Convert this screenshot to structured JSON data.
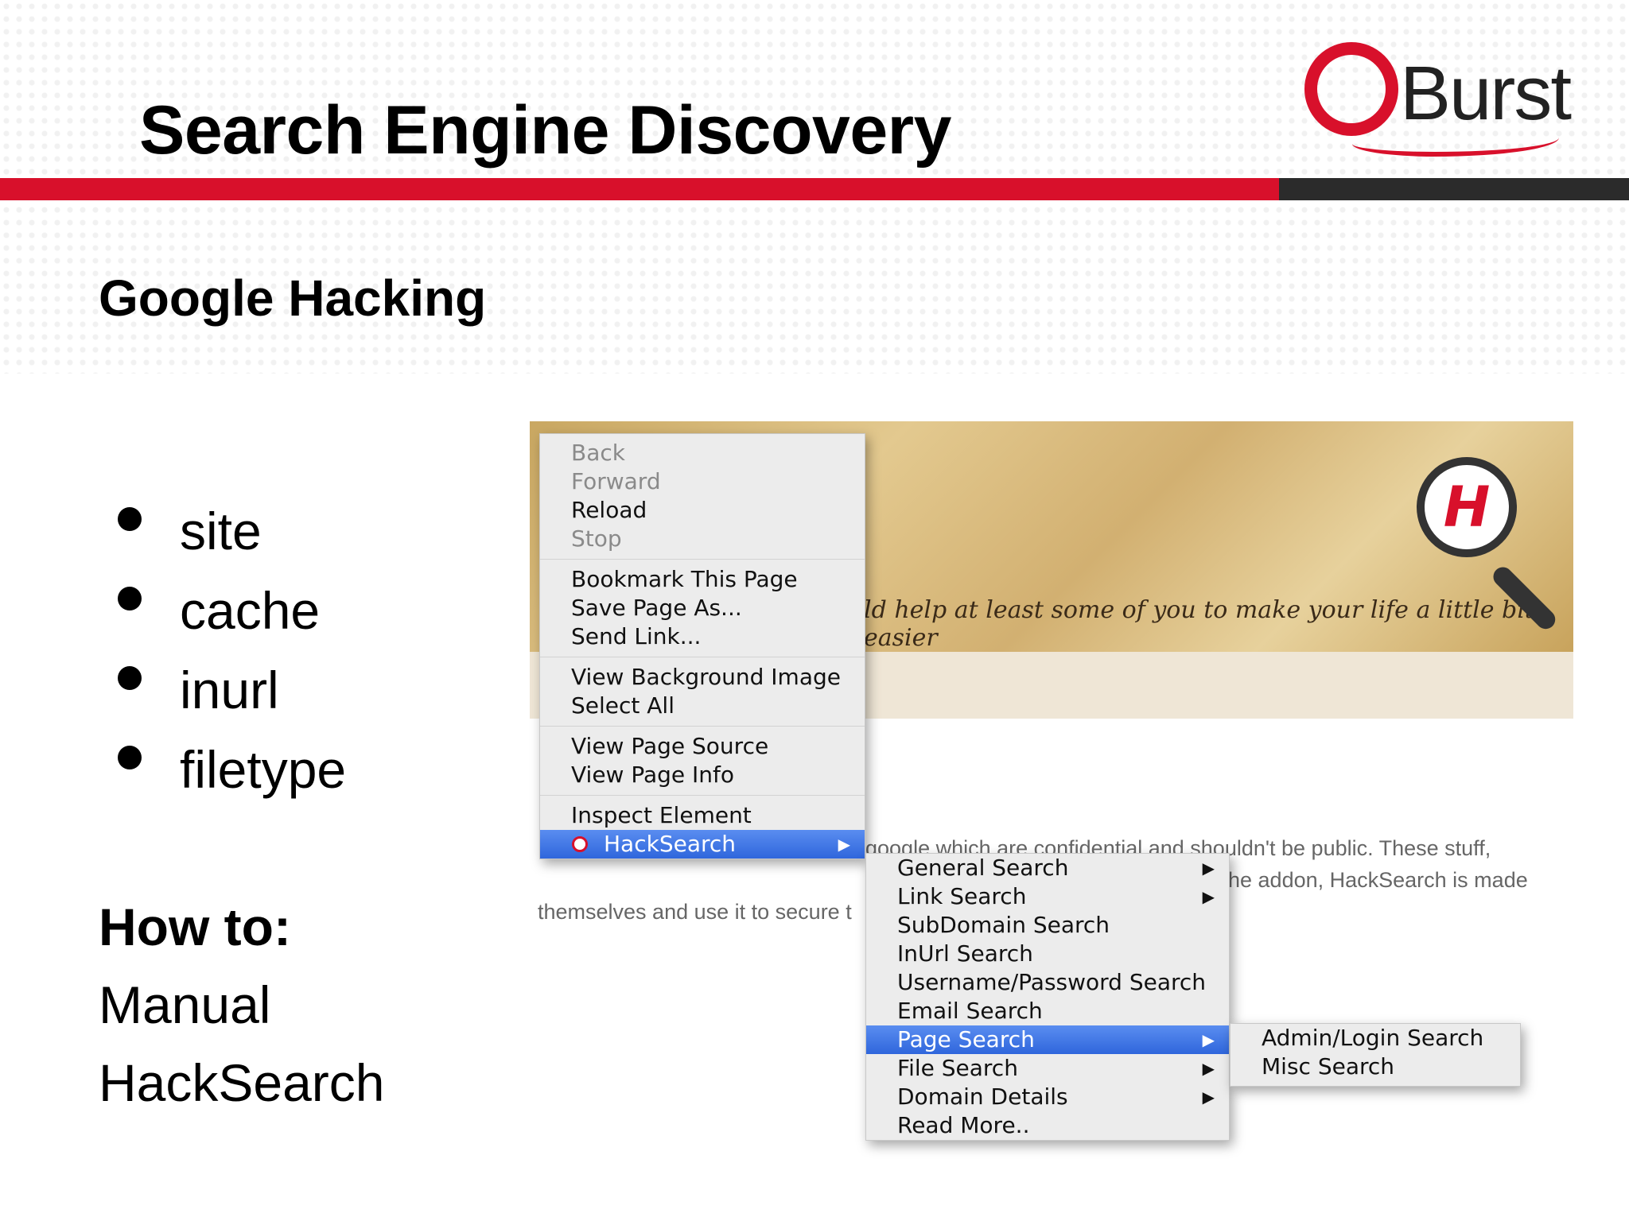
{
  "slide": {
    "title": "Search Engine Discovery",
    "logo_text": "Burst",
    "subtitle": "Google Hacking",
    "bullets": [
      "site",
      "cache",
      "inurl",
      "filetype"
    ],
    "howto": {
      "heading": "How to:",
      "lines": [
        "Manual",
        "HackSearch"
      ]
    }
  },
  "screenshot": {
    "banner_quote": "ld help at least some of you to make your life a little bit easier",
    "banner_logo_letter": "H",
    "page_text": [
      "google which are confidential and shouldn't be public. These stuff,",
      "he addon, HackSearch is made",
      "themselves and use it to secure t"
    ],
    "context_menu": {
      "groups": [
        [
          {
            "label": "Back",
            "disabled": true
          },
          {
            "label": "Forward",
            "disabled": true
          },
          {
            "label": "Reload",
            "disabled": false
          },
          {
            "label": "Stop",
            "disabled": true
          }
        ],
        [
          {
            "label": "Bookmark This Page"
          },
          {
            "label": "Save Page As..."
          },
          {
            "label": "Send Link..."
          }
        ],
        [
          {
            "label": "View Background Image"
          },
          {
            "label": "Select All"
          }
        ],
        [
          {
            "label": "View Page Source"
          },
          {
            "label": "View Page Info"
          }
        ],
        [
          {
            "label": "Inspect Element"
          },
          {
            "label": "HackSearch",
            "active": true,
            "submenu": true
          }
        ]
      ]
    },
    "hacksearch_menu": [
      {
        "label": "General Search",
        "submenu": true
      },
      {
        "label": "Link Search",
        "submenu": true
      },
      {
        "label": "SubDomain Search"
      },
      {
        "label": "InUrl Search"
      },
      {
        "label": "Username/Password Search"
      },
      {
        "label": "Email Search"
      },
      {
        "label": "Page Search",
        "submenu": true,
        "active": true
      },
      {
        "label": "File Search",
        "submenu": true
      },
      {
        "label": "Domain Details",
        "submenu": true
      },
      {
        "label": "Read More.."
      }
    ],
    "page_search_menu": [
      {
        "label": "Admin/Login Search"
      },
      {
        "label": "Misc Search"
      }
    ]
  },
  "colors": {
    "brand_red": "#d8102b",
    "rule_dark": "#2b2b2b",
    "menu_highlight": "#3a72e4"
  }
}
